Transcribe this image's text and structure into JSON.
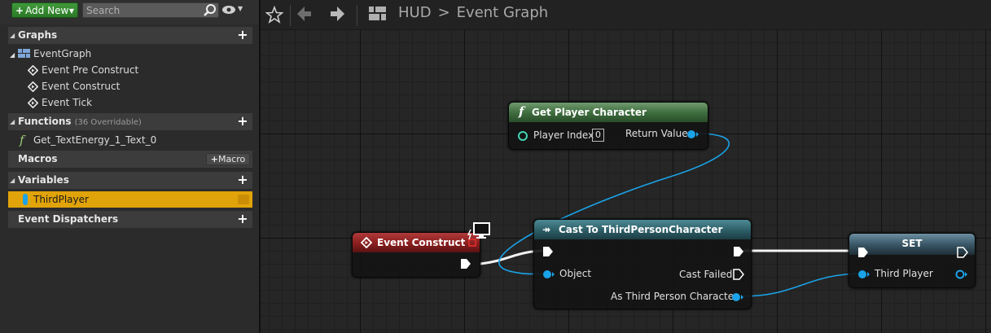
{
  "panel": {
    "add_new_label": "Add New",
    "search_placeholder": "Search",
    "graphs": {
      "title": "Graphs",
      "root": "EventGraph",
      "events": [
        "Event Pre Construct",
        "Event Construct",
        "Event Tick"
      ]
    },
    "functions": {
      "title": "Functions",
      "count_label": "(36 Overridable)",
      "items": [
        "Get_TextEnergy_1_Text_0"
      ]
    },
    "macros": {
      "title": "Macros",
      "add_label": "Macro"
    },
    "variables": {
      "title": "Variables",
      "items": [
        "ThirdPlayer"
      ]
    },
    "dispatchers": {
      "title": "Event Dispatchers"
    }
  },
  "toolbar": {
    "breadcrumb": [
      "HUD",
      "Event Graph"
    ]
  },
  "nodes": {
    "get_player_character": {
      "title": "Get Player Character",
      "player_index_label": "Player Index",
      "player_index_value": "0",
      "return_value_label": "Return Value"
    },
    "event_construct": {
      "title": "Event Construct"
    },
    "cast": {
      "title": "Cast To ThirdPersonCharacter",
      "object_label": "Object",
      "cast_failed_label": "Cast Failed",
      "as_label": "As Third Person Character"
    },
    "set": {
      "title": "SET",
      "third_player_label": "Third Player"
    }
  },
  "colors": {
    "accent_selected": "#e0a30a",
    "add_new_green": "#3f9a3a",
    "object_pin_blue": "#1aa3e8",
    "event_header_red": "#8a1e1e",
    "pure_header_green": "#3c6b3c",
    "cast_header_teal": "#2d5d66"
  }
}
